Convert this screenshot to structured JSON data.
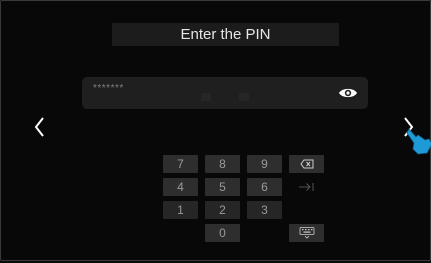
{
  "header": {
    "title": "Enter the PIN"
  },
  "pin": {
    "masked_value": "*******"
  },
  "keypad": {
    "rows": [
      [
        {
          "label": "7",
          "name": "key-7"
        },
        {
          "label": "8",
          "name": "key-8"
        },
        {
          "label": "9",
          "name": "key-9"
        }
      ],
      [
        {
          "label": "4",
          "name": "key-4"
        },
        {
          "label": "5",
          "name": "key-5"
        },
        {
          "label": "6",
          "name": "key-6"
        }
      ],
      [
        {
          "label": "1",
          "name": "key-1"
        },
        {
          "label": "2",
          "name": "key-2"
        },
        {
          "label": "3",
          "name": "key-3"
        }
      ],
      [
        {
          "label": "0",
          "name": "key-0"
        }
      ]
    ],
    "function_icons": [
      "backspace-icon",
      "tab-icon",
      "keyboard-hide-icon"
    ]
  },
  "icons": {
    "prev": "chevron-left-icon",
    "next": "chevron-right-icon",
    "eye": "eye-icon",
    "pointer": "hand-pointer-icon"
  },
  "colors": {
    "background": "#080808",
    "panel": "#1c1c1c",
    "key": "#2e2e2e",
    "text": "#e6e6e6",
    "pointer": "#1e9bd7"
  }
}
